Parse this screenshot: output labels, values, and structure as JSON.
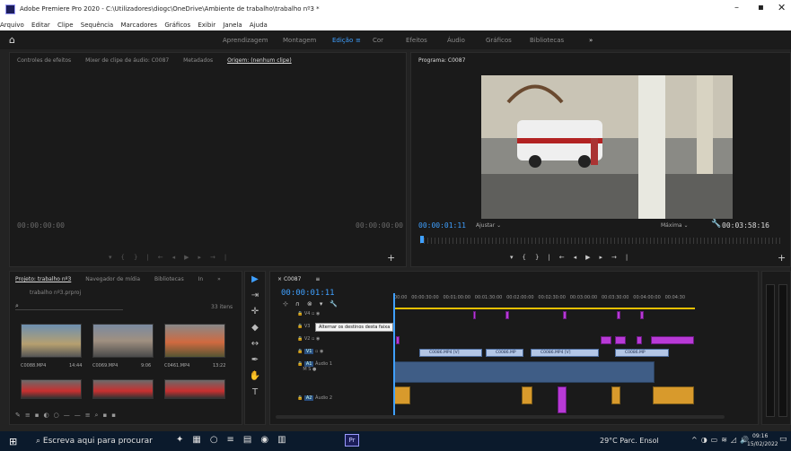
{
  "window": {
    "title": "Adobe Premiere Pro 2020 - C:\\Utilizadores\\diogc\\OneDrive\\Ambiente de trabalho\\trabalho nº3 *"
  },
  "menu": [
    "Arquivo",
    "Editar",
    "Clipe",
    "Sequência",
    "Marcadores",
    "Gráficos",
    "Exibir",
    "Janela",
    "Ajuda"
  ],
  "workspaces": [
    "Aprendizagem",
    "Montagem",
    "Edição",
    "Cor",
    "Efeitos",
    "Áudio",
    "Gráficos",
    "Bibliotecas",
    "»"
  ],
  "source": {
    "tabs": [
      "Controles de efeitos",
      "Mixer de clipe de áudio: C0087",
      "Metadados",
      "Origem: (nenhum clipe)"
    ],
    "tc_left": "00:00:00:00",
    "tc_right": "00:00:00:00"
  },
  "program": {
    "tab": "Programa: C0087",
    "tc": "00:00:01:11",
    "fit": "Ajustar",
    "quality": "Máxima",
    "duration": "00:03:58:16"
  },
  "project": {
    "tabs": [
      "Projeto: trabalho nº3",
      "Navegador de mídia",
      "Bibliotecas",
      "In",
      "»"
    ],
    "path": "trabalho nº3.prproj",
    "items_count": "33 itens",
    "items": [
      {
        "name": "C0088.MP4",
        "dur": "14:44"
      },
      {
        "name": "C0069.MP4",
        "dur": "9:06"
      },
      {
        "name": "C0461.MP4",
        "dur": "13:22"
      }
    ]
  },
  "timeline": {
    "sequence": "C0087",
    "tc": "00:00:01:11",
    "ruler": [
      "00:00",
      "00:00:30:00",
      "00:01:00:00",
      "00:01:30:00",
      "00:02:00:00",
      "00:02:30:00",
      "00:03:00:00",
      "00:03:30:00",
      "00:04:00:00",
      "00:04:30"
    ],
    "tooltip": "Alternar os destinos desta faixa",
    "tracks": [
      "V4",
      "V3",
      "V2",
      "V1",
      "A1",
      "A2"
    ],
    "audio1_name": "Áudio 1",
    "audio2_name": "Áudio 2",
    "clip_labels": [
      "C0086.MP4 [V]",
      "C0086.MP",
      "C0086.MP4 [V]",
      "C0086.MP"
    ]
  },
  "taskbar": {
    "search": "Escreva aqui para procurar",
    "weather": "29°C  Parc. Ensol",
    "time": "09:16",
    "date": "15/02/2022"
  },
  "colors": {
    "accent": "#3fa0ff",
    "video_clip": "#b3c6e6",
    "pink_clip": "#b83ad6",
    "audio_clip": "#3f5d86",
    "orange_clip": "#d89a2c",
    "playhead": "#3fa0ff"
  }
}
